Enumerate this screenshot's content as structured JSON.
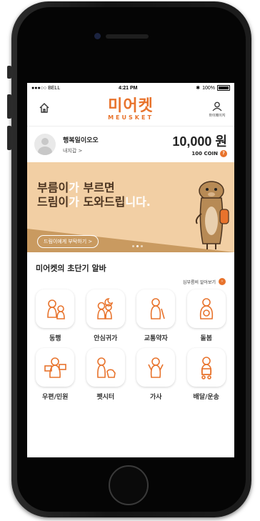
{
  "status_bar": {
    "carrier": "●●●○○ BELL",
    "time": "4:21 PM",
    "battery": "100%"
  },
  "header": {
    "logo_korean": "미어켓",
    "logo_english": "MEUSKET",
    "my_label": "마이페이지"
  },
  "wallet": {
    "user_name": "행복일이오오",
    "wallet_link": "내지갑 >",
    "amount": "10,000 원",
    "coin": "100 COIN",
    "coin_help": "?"
  },
  "banner": {
    "line1_a": "부름이",
    "line1_b": "가",
    "line1_c": " 부르면",
    "line2_a": "드림이",
    "line2_b": "가",
    "line2_c": " 도와드립",
    "line2_d": "니다.",
    "button": "드림이에게 부탁하기 >"
  },
  "section": {
    "title": "미어켓의 초단기 알바",
    "more_link": "심부름비 알아보기",
    "more_icon": "›"
  },
  "services": [
    {
      "label": "동행",
      "icon": "companion-icon"
    },
    {
      "label": "안심귀가",
      "icon": "safe-home-icon"
    },
    {
      "label": "교통약자",
      "icon": "mobility-aid-icon"
    },
    {
      "label": "돌봄",
      "icon": "care-icon"
    },
    {
      "label": "우편/민원",
      "icon": "mail-icon"
    },
    {
      "label": "펫시터",
      "icon": "pet-sitter-icon"
    },
    {
      "label": "가사",
      "icon": "housework-icon"
    },
    {
      "label": "배달/운송",
      "icon": "delivery-icon"
    }
  ],
  "colors": {
    "accent": "#e8732c",
    "banner_bg": "#f2cfa4",
    "banner_band": "#c99a60"
  }
}
